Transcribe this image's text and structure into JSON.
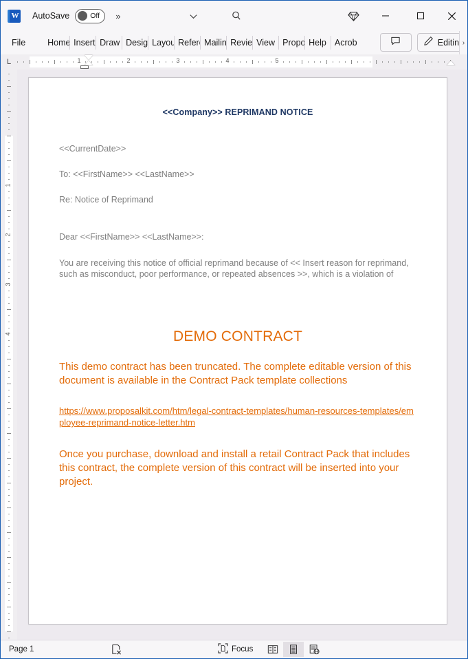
{
  "titlebar": {
    "app_icon": "word-icon",
    "autosave_label": "AutoSave",
    "autosave_state": "Off",
    "more_commands": "»",
    "customize_chevron": "chevron-down-icon",
    "search": "search-icon",
    "copilot": "diamond-icon",
    "minimize": "minimize-icon",
    "maximize": "maximize-icon",
    "close": "close-icon"
  },
  "ribbon": {
    "tabs": [
      {
        "label": "File"
      },
      {
        "label": "Home"
      },
      {
        "label": "Insert"
      },
      {
        "label": "Draw"
      },
      {
        "label": "Design"
      },
      {
        "label": "Layout"
      },
      {
        "label": "References"
      },
      {
        "label": "Mailings"
      },
      {
        "label": "Review"
      },
      {
        "label": "View"
      },
      {
        "label": "Proposal Kit"
      },
      {
        "label": "Help"
      },
      {
        "label": "Acrobat"
      }
    ],
    "comment_button": "comment-icon",
    "editing_label": "Editing",
    "editing_icon": "pencil-icon",
    "expand_chevron": "›"
  },
  "ruler": {
    "tabstop_marker": "L",
    "h_numbers": [
      "1",
      "2",
      "3",
      "4",
      "5"
    ],
    "v_numbers": [
      "1",
      "2",
      "3",
      "4"
    ]
  },
  "document": {
    "title": "<<Company>> REPRIMAND NOTICE",
    "title_color": "#1f3864",
    "body_color": "#808080",
    "accent_color": "#e36c0a",
    "paragraphs": [
      "<<CurrentDate>>",
      "To: <<FirstName>> <<LastName>>",
      "Re: Notice of Reprimand",
      "Dear <<FirstName>> <<LastName>>:",
      "You are receiving this notice of official reprimand because of << Insert reason for reprimand, such as misconduct, poor performance, or repeated absences >>, which is a violation of"
    ],
    "demo_title": "DEMO CONTRACT",
    "demo_paragraph_1": "This demo contract has been truncated. The complete editable version of this document is available in the Contract Pack template collections",
    "demo_link": "https://www.proposalkit.com/htm/legal-contract-templates/human-resources-templates/employee-reprimand-notice-letter.htm",
    "demo_paragraph_2": "Once you purchase, download and install a retail Contract Pack that includes this contract, the complete version of this contract will be inserted into your project."
  },
  "statusbar": {
    "page_label": "Page 1",
    "proofing_icon": "proofing-errors-icon",
    "focus_label": "Focus",
    "focus_icon": "focus-icon",
    "views": [
      {
        "name": "read-mode",
        "active": false
      },
      {
        "name": "print-layout",
        "active": true
      },
      {
        "name": "web-layout",
        "active": false
      }
    ]
  }
}
